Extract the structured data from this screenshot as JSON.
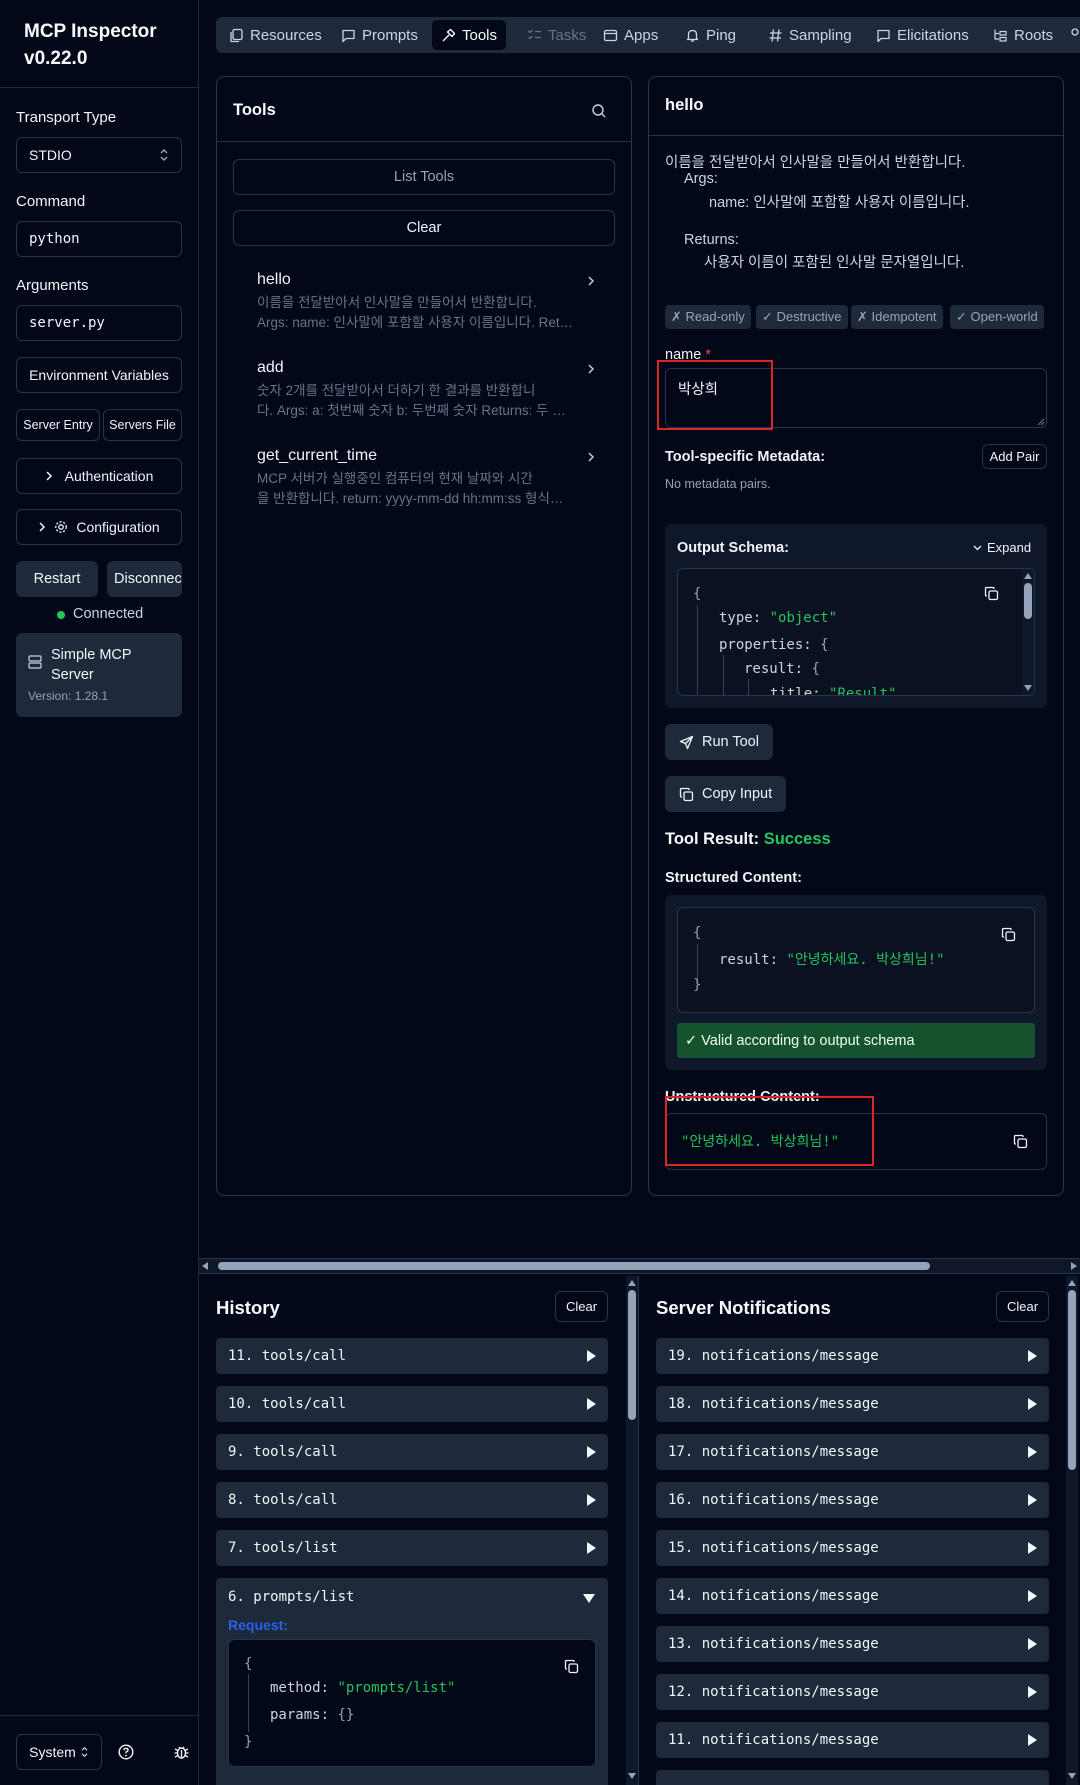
{
  "sidebar": {
    "title_line1": "MCP Inspector",
    "title_line2": "v0.22.0",
    "transport_label": "Transport Type",
    "transport_value": "STDIO",
    "command_label": "Command",
    "command_value": "python",
    "arguments_label": "Arguments",
    "arguments_value": "server.py",
    "env_button": "Environment Variables",
    "server_entry_button": "Server Entry",
    "servers_file_button": "Servers File",
    "auth_button": "Authentication",
    "config_button": "Configuration",
    "restart_button": "Restart",
    "disconnect_button": "Disconnect",
    "status": "Connected",
    "server_name_line1": "Simple MCP",
    "server_name_line2": "Server",
    "server_version": "Version: 1.28.1",
    "theme_select": "System"
  },
  "tabs": [
    {
      "label": "Resources",
      "icon": "files-icon"
    },
    {
      "label": "Prompts",
      "icon": "message-square-icon"
    },
    {
      "label": "Tools",
      "icon": "hammer-icon"
    },
    {
      "label": "Tasks",
      "icon": "list-checks-icon"
    },
    {
      "label": "Apps",
      "icon": "app-window-icon"
    },
    {
      "label": "Ping",
      "icon": "bell-icon"
    },
    {
      "label": "Sampling",
      "icon": "hash-icon"
    },
    {
      "label": "Elicitations",
      "icon": "message-square-icon"
    },
    {
      "label": "Roots",
      "icon": "folder-tree-icon"
    }
  ],
  "tools_panel": {
    "title": "Tools",
    "list_button": "List Tools",
    "clear_button": "Clear",
    "items": [
      {
        "name": "hello",
        "desc1": "이름을 전달받아서 인사말을 만들어서 반환합니다.",
        "desc2": "Args: name: 인사말에 포함할 사용자 이름입니다. Returns: 사용자 이름이 포함된 인사말 문자열입니다."
      },
      {
        "name": "add",
        "desc1": "숫자 2개를 전달받아서 더하기 한 결과를 반환합니",
        "desc2": "다. Args: a: 첫번째 숫자 b: 두번째 숫자 Returns: 두 숫자를 더한 결과입니다."
      },
      {
        "name": "get_current_time",
        "desc1": "MCP 서버가 실행중인 컴퓨터의 현재 날짜와 시간",
        "desc2": "을 반환합니다. return: yyyy-mm-dd hh:mm:ss 형식의 문자열"
      }
    ]
  },
  "detail": {
    "title": "hello",
    "desc_line1": "이름을 전달받아서 인사말을 만들어서 반환합니다.",
    "desc_line2": "Args:",
    "desc_line3": "name: 인사말에 포함할 사용자 이름입니다.",
    "desc_line4": "Returns:",
    "desc_line5": "사용자 이름이 포함된 인사말 문자열입니다.",
    "badges": [
      "✗ Read-only",
      "✓ Destructive",
      "✗ Idempotent",
      "✓ Open-world"
    ],
    "name_label": "name",
    "required_mark": "*",
    "name_value": "박상희",
    "metadata_label": "Tool-specific Metadata:",
    "add_pair_button": "Add Pair",
    "no_metadata": "No metadata pairs.",
    "output_schema_label": "Output Schema:",
    "expand_button": "Expand",
    "schema": {
      "open_brace": "{",
      "type_key": "type:",
      "type_val": "\"object\"",
      "properties_key": "properties:",
      "properties_brace": "{",
      "result_key": "result:",
      "result_brace": "{",
      "title_key": "title:",
      "title_val": "\"Result\""
    },
    "run_button": "Run Tool",
    "copy_input_button": "Copy Input",
    "result_label": "Tool Result:",
    "result_status": "Success",
    "structured_label": "Structured Content:",
    "structured": {
      "open_brace": "{",
      "key": "result:",
      "value": "\"안녕하세요. 박상희님!\"",
      "close_brace": "}"
    },
    "valid_message": "✓ Valid according to output schema",
    "unstructured_label": "Unstructured Content:",
    "unstructured_value": "\"안녕하세요. 박상희님!\""
  },
  "history": {
    "title": "History",
    "clear_button": "Clear",
    "items": [
      "11. tools/call",
      "10. tools/call",
      "9. tools/call",
      "8. tools/call",
      "7. tools/list",
      "6. prompts/list"
    ],
    "request_label": "Request:",
    "request": {
      "open_brace": "{",
      "method_key": "method:",
      "method_val": "\"prompts/list\"",
      "params_key": "params:",
      "params_val": "{}",
      "close_brace": "}"
    }
  },
  "notifications": {
    "title": "Server Notifications",
    "clear_button": "Clear",
    "items": [
      "19. notifications/message",
      "18. notifications/message",
      "17. notifications/message",
      "16. notifications/message",
      "15. notifications/message",
      "14. notifications/message",
      "13. notifications/message",
      "12. notifications/message",
      "11. notifications/message"
    ]
  },
  "colors": {
    "background": "#020817",
    "surface": "#1e293b",
    "success": "#22c55e",
    "highlight": "#dc2626",
    "link": "#2563eb"
  }
}
